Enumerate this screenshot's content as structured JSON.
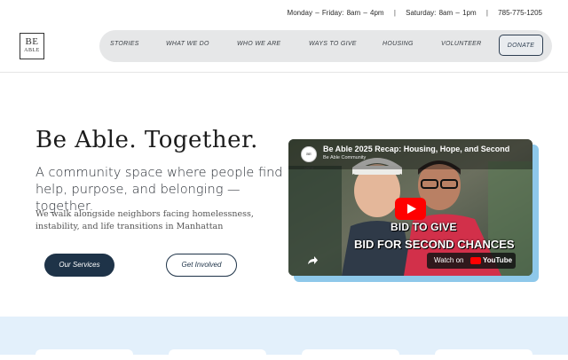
{
  "topbar": {
    "weekday_hours": "Monday  –  Friday:  8am  –  4pm",
    "saturday_hours": "Saturday:  8am  –  1pm",
    "phone": "785-775-1205",
    "separator": "|"
  },
  "logo": {
    "line1": "BE",
    "line2": "ABLE"
  },
  "nav": {
    "items": [
      "STORIES",
      "WHAT WE DO",
      "WHO WE ARE",
      "WAYS TO GIVE",
      "HOUSING",
      "VOLUNTEER"
    ],
    "donate": "DONATE"
  },
  "hero": {
    "title": "Be Able. Together.",
    "subtitle": "A community space where people find help, purpose, and belonging — together.",
    "description": "We walk alongside neighbors facing homelessness, instability, and life transitions in Manhattan",
    "primary_button": "Our Services",
    "secondary_button": "Get Involved"
  },
  "video": {
    "title": "Be Able 2025 Recap: Housing, Hope, and Second",
    "channel": "Be Able Community",
    "channel_avatar_text": "BE ABLE",
    "overlay_line1": "BID TO GIVE",
    "overlay_line2": "BID FOR SECOND CHANCES",
    "watch_on": "Watch on",
    "youtube": "YouTube"
  },
  "colors": {
    "primary": "#1e3348",
    "nav_bg": "#e6e7e8",
    "video_shadow": "#8ec8ea",
    "band": "#e3f0fb"
  }
}
